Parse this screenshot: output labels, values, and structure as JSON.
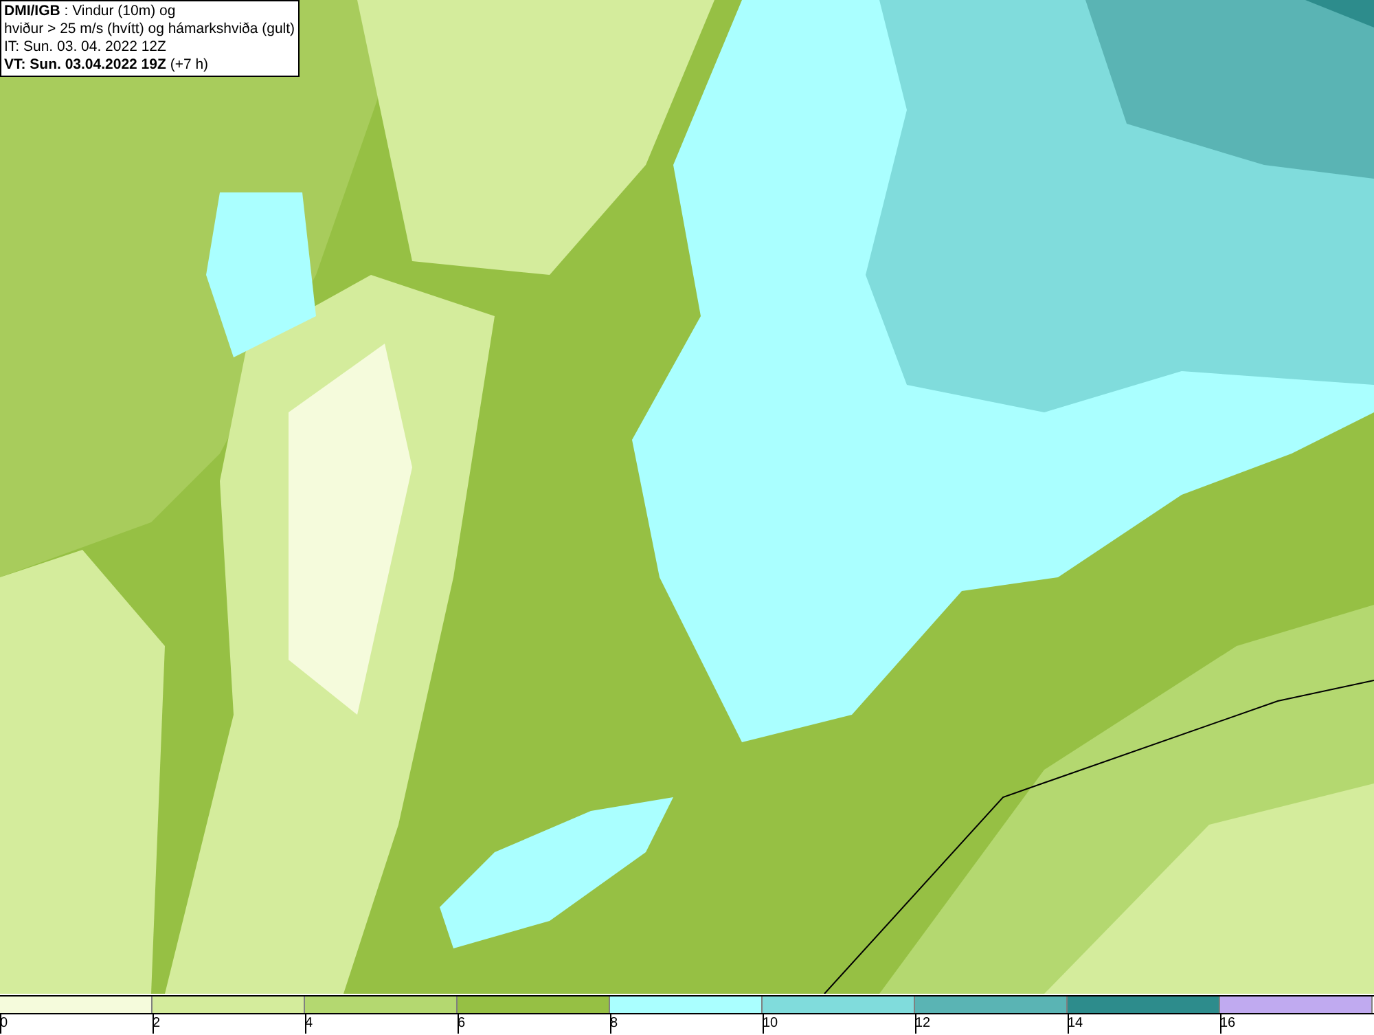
{
  "header": {
    "lines": [
      "**DMI/IGB** : Vindur (10m) og",
      "hviður > 25 m/s (hvítt) og hámarkshviða (gult)",
      "IT: Sun. 03. 04. 2022 12Z",
      "**VT: Sun. 03.04.2022 19Z** (+7 h)"
    ]
  },
  "legend": {
    "bins": [
      {
        "color": "#f5fbdc"
      },
      {
        "color": "#d4ec9c"
      },
      {
        "color": "#b4d870"
      },
      {
        "color": "#96c044"
      },
      {
        "color": "#aaffff"
      },
      {
        "color": "#80dcdc"
      },
      {
        "color": "#5ab4b4"
      },
      {
        "color": "#2d8c8c"
      },
      {
        "color": "#c0aaf0"
      }
    ],
    "ticks": [
      "0",
      "2",
      "4",
      "6",
      "8",
      "10",
      "12",
      "14",
      "16"
    ]
  }
}
